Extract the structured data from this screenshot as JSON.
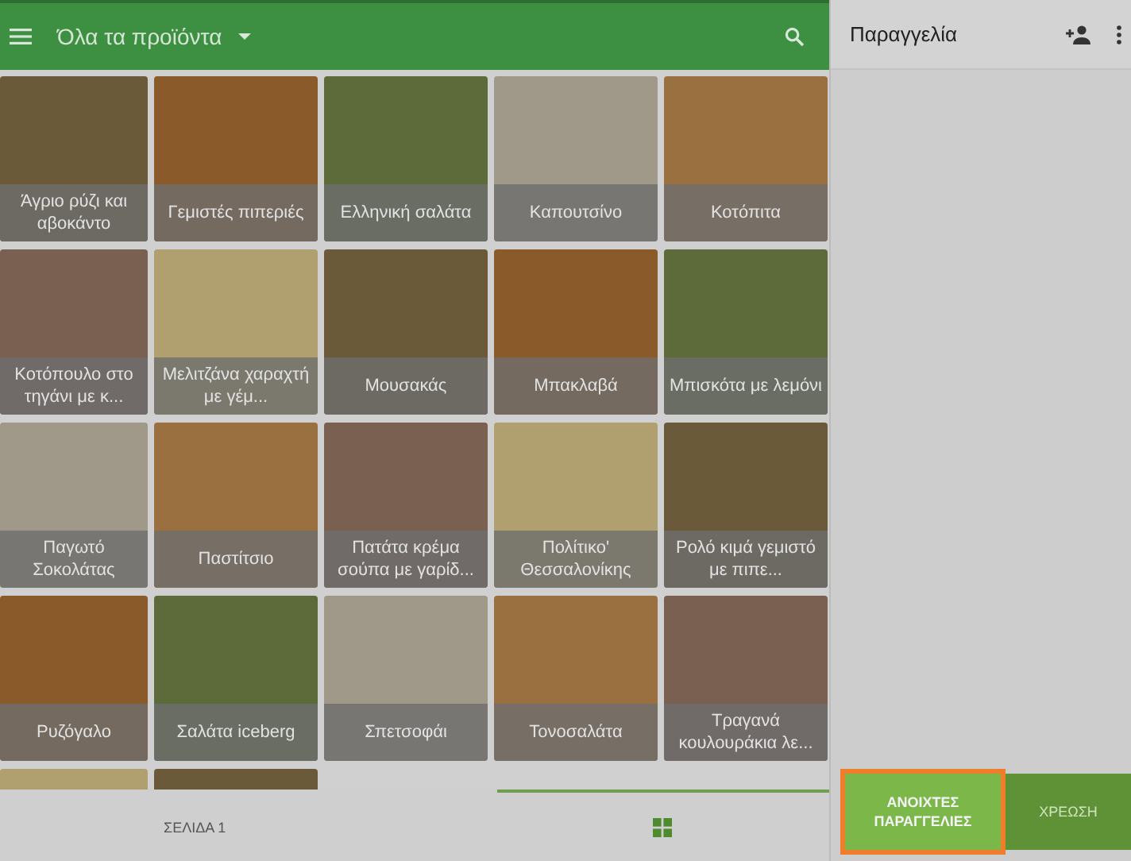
{
  "app_bar": {
    "category": "Όλα τα προϊόντα"
  },
  "products": [
    {
      "kind": "dish",
      "name": "Άγριο ρύζι και αβοκάντο"
    },
    {
      "kind": "dish",
      "name": "Γεμιστές πιπεριές"
    },
    {
      "kind": "dish",
      "name": "Ελληνική σαλάτα"
    },
    {
      "kind": "dish",
      "name": "Καπουτσίνο"
    },
    {
      "kind": "dish",
      "name": "Κοτόπιτα"
    },
    {
      "kind": "dish",
      "name": "Κοτόπουλο στο τηγάνι με κ..."
    },
    {
      "kind": "dish",
      "name": "Μελιτζάνα χαραχτή με γέμ..."
    },
    {
      "kind": "dish",
      "name": "Μουσακάς"
    },
    {
      "kind": "dish",
      "name": "Μπακλαβά"
    },
    {
      "kind": "dish",
      "name": "Μπισκότα με λεμόνι"
    },
    {
      "kind": "dish",
      "name": "Παγωτό Σοκολάτας"
    },
    {
      "kind": "dish",
      "name": "Παστίτσιο"
    },
    {
      "kind": "dish",
      "name": "Πατάτα κρέμα σούπα με γαρίδ..."
    },
    {
      "kind": "dish",
      "name": "Πολίτικο' Θεσσαλονίκης"
    },
    {
      "kind": "dish",
      "name": "Ρολό κιμά γεμιστό με πιπε..."
    },
    {
      "kind": "dish",
      "name": "Ρυζόγαλο"
    },
    {
      "kind": "dish",
      "name": "Σαλάτα iceberg"
    },
    {
      "kind": "dish",
      "name": "Σπετσοφάι"
    },
    {
      "kind": "dish",
      "name": "Τονοσαλάτα"
    },
    {
      "kind": "dish",
      "name": "Τραγανά κουλουράκια λε..."
    },
    {
      "kind": "photo"
    },
    {
      "kind": "photo"
    }
  ],
  "bottom_tabs": [
    {
      "kind": "text",
      "label": "ΣΕΛΙΔΑ 1",
      "selected": false
    },
    {
      "kind": "grid",
      "selected": true
    }
  ],
  "order_panel": {
    "title": "Παραγγελία",
    "buttons": [
      {
        "label": "ΑΝΟΙΧΤΕΣ ΠΑΡΑΓΓΕΛΙΕΣ",
        "highlighted": true
      },
      {
        "label": "ΧΡΕΩΣΗ",
        "highlighted": false
      }
    ]
  }
}
